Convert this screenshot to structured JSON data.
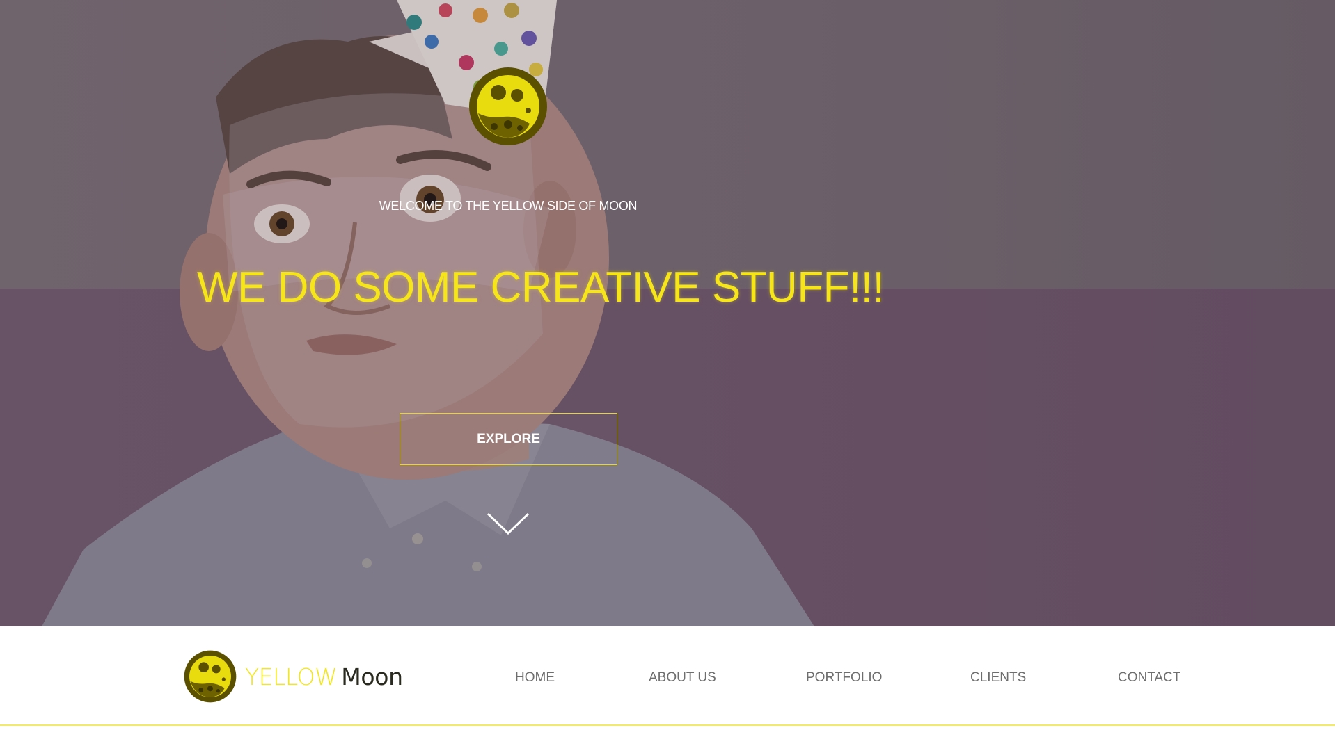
{
  "hero": {
    "welcome": "WELCOME TO THE YELLOW SIDE OF MOON",
    "title": "WE DO SOME CREATIVE STUFF!!!",
    "explore_label": "EXPLORE",
    "scroll_icon": "chevron-down-icon",
    "logo_icon": "yellow-moon-logo"
  },
  "brand": {
    "part1": "YELLOW",
    "part2": "Moon",
    "logo_icon": "yellow-moon-logo"
  },
  "nav": {
    "items": [
      {
        "label": "HOME"
      },
      {
        "label": "ABOUT US"
      },
      {
        "label": "PORTFOLIO"
      },
      {
        "label": "CLIENTS"
      },
      {
        "label": "CONTACT"
      }
    ]
  },
  "colors": {
    "accent": "#f5e51a",
    "nav_text": "#6e6e6e",
    "logo_dark": "#5c5200"
  }
}
